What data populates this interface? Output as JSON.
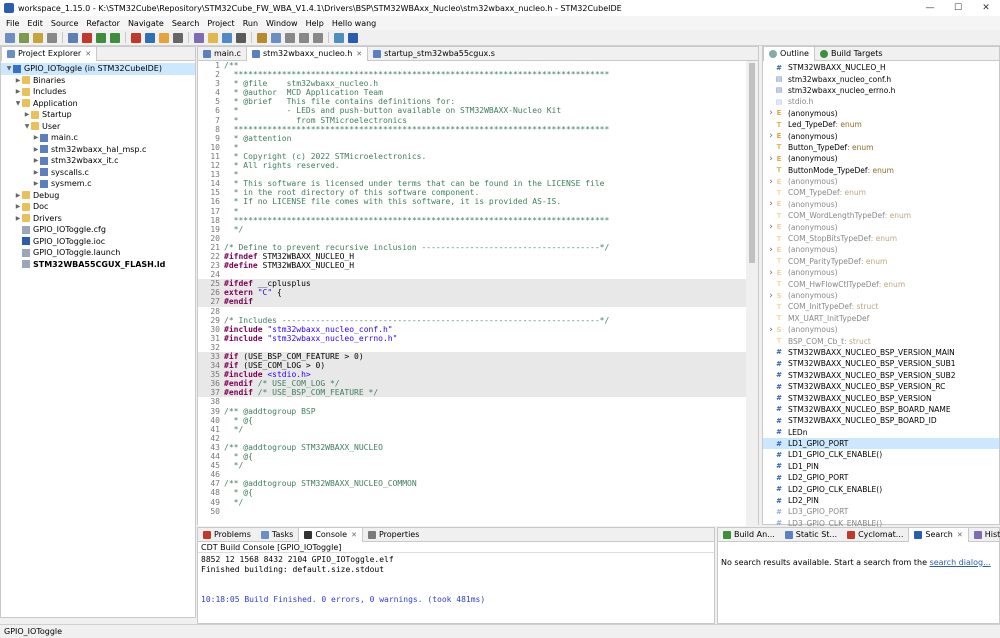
{
  "window": {
    "title": "workspace_1.15.0 - K:\\STM32Cube\\Repository\\STM32Cube_FW_WBA_V1.4.1\\Drivers\\BSP\\STM32WBAxx_Nucleo\\stm32wbaxx_nucleo.h - STM32CubeIDE",
    "minimize": "—",
    "maximize": "☐",
    "close": "✕"
  },
  "menu": [
    "File",
    "Edit",
    "Source",
    "Refactor",
    "Navigate",
    "Search",
    "Project",
    "Run",
    "Window",
    "Help",
    "Hello wang"
  ],
  "explorer": {
    "tab": "Project Explorer",
    "items": [
      {
        "label": "GPIO_IOToggle (in STM32CubeIDE)",
        "depth": 0,
        "tw": "v",
        "icon": "project",
        "sel": true
      },
      {
        "label": "Binaries",
        "depth": 1,
        "tw": ">",
        "icon": "folder"
      },
      {
        "label": "Includes",
        "depth": 1,
        "tw": ">",
        "icon": "folder"
      },
      {
        "label": "Application",
        "depth": 1,
        "tw": "v",
        "icon": "folder"
      },
      {
        "label": "Startup",
        "depth": 2,
        "tw": ">",
        "icon": "folder"
      },
      {
        "label": "User",
        "depth": 2,
        "tw": "v",
        "icon": "folder"
      },
      {
        "label": "main.c",
        "depth": 3,
        "tw": ">",
        "icon": "cfile"
      },
      {
        "label": "stm32wbaxx_hal_msp.c",
        "depth": 3,
        "tw": ">",
        "icon": "cfile"
      },
      {
        "label": "stm32wbaxx_it.c",
        "depth": 3,
        "tw": ">",
        "icon": "cfile"
      },
      {
        "label": "syscalls.c",
        "depth": 3,
        "tw": ">",
        "icon": "cfile"
      },
      {
        "label": "sysmem.c",
        "depth": 3,
        "tw": ">",
        "icon": "cfile"
      },
      {
        "label": "Debug",
        "depth": 1,
        "tw": ">",
        "icon": "folder"
      },
      {
        "label": "Doc",
        "depth": 1,
        "tw": ">",
        "icon": "folder"
      },
      {
        "label": "Drivers",
        "depth": 1,
        "tw": ">",
        "icon": "folder"
      },
      {
        "label": "GPIO_IOToggle.cfg",
        "depth": 1,
        "tw": "",
        "icon": "file"
      },
      {
        "label": "GPIO_IOToggle.ioc",
        "depth": 1,
        "tw": "",
        "icon": "mx"
      },
      {
        "label": "GPIO_IOToggle.launch",
        "depth": 1,
        "tw": "",
        "icon": "file"
      },
      {
        "label": "STM32WBA55CGUX_FLASH.ld",
        "depth": 1,
        "tw": "",
        "icon": "file",
        "bold": true
      }
    ]
  },
  "editor": {
    "tabs": [
      {
        "label": "main.c"
      },
      {
        "label": "stm32wbaxx_nucleo.h",
        "active": true
      },
      {
        "label": "startup_stm32wba55cgux.s"
      }
    ],
    "lines": [
      {
        "n": "1",
        "t": [
          [
            "cm",
            "/**"
          ]
        ]
      },
      {
        "n": "2",
        "t": [
          [
            "cm",
            "  ******************************************************************************"
          ]
        ]
      },
      {
        "n": "3",
        "t": [
          [
            "cm",
            "  * @file    stm32wbaxx_nucleo.h"
          ]
        ]
      },
      {
        "n": "4",
        "t": [
          [
            "cm",
            "  * @author  MCD Application Team"
          ]
        ]
      },
      {
        "n": "5",
        "t": [
          [
            "cm",
            "  * @brief   This file contains definitions for:"
          ]
        ]
      },
      {
        "n": "6",
        "t": [
          [
            "cm",
            "  *          - LEDs and push-button available on STM32WBAXX-Nucleo Kit"
          ]
        ]
      },
      {
        "n": "7",
        "t": [
          [
            "cm",
            "  *            from STMicroelectronics"
          ]
        ]
      },
      {
        "n": "8",
        "t": [
          [
            "cm",
            "  ******************************************************************************"
          ]
        ]
      },
      {
        "n": "9",
        "t": [
          [
            "cm",
            "  * @attention"
          ]
        ]
      },
      {
        "n": "10",
        "t": [
          [
            "cm",
            "  *"
          ]
        ]
      },
      {
        "n": "11",
        "t": [
          [
            "cm",
            "  * Copyright (c) 2022 STMicroelectronics."
          ]
        ]
      },
      {
        "n": "12",
        "t": [
          [
            "cm",
            "  * All rights reserved."
          ]
        ]
      },
      {
        "n": "13",
        "t": [
          [
            "cm",
            "  *"
          ]
        ]
      },
      {
        "n": "14",
        "t": [
          [
            "cm",
            "  * This software is licensed under terms that can be found in the LICENSE file"
          ]
        ]
      },
      {
        "n": "15",
        "t": [
          [
            "cm",
            "  * in the root directory of this software component."
          ]
        ]
      },
      {
        "n": "16",
        "t": [
          [
            "cm",
            "  * If no LICENSE file comes with this software, it is provided AS-IS."
          ]
        ]
      },
      {
        "n": "17",
        "t": [
          [
            "cm",
            "  *"
          ]
        ]
      },
      {
        "n": "18",
        "t": [
          [
            "cm",
            "  ******************************************************************************"
          ]
        ]
      },
      {
        "n": "19",
        "t": [
          [
            "cm",
            "  */"
          ]
        ]
      },
      {
        "n": "20",
        "t": [
          [
            "",
            ""
          ]
        ]
      },
      {
        "n": "21",
        "t": [
          [
            "cm",
            "/* Define to prevent recursive inclusion -------------------------------------*/"
          ]
        ]
      },
      {
        "n": "22",
        "t": [
          [
            "pp",
            "#ifndef"
          ],
          [
            "",
            " STM32WBAXX_NUCLEO_H"
          ]
        ]
      },
      {
        "n": "23",
        "t": [
          [
            "pp",
            "#define"
          ],
          [
            "",
            " STM32WBAXX_NUCLEO_H"
          ]
        ]
      },
      {
        "n": "24",
        "t": [
          [
            "",
            ""
          ]
        ]
      },
      {
        "n": "25",
        "t": [
          [
            "pp",
            "#ifdef"
          ],
          [
            "",
            " __cplusplus"
          ]
        ],
        "hl": true
      },
      {
        "n": "26",
        "t": [
          [
            "pp",
            "extern"
          ],
          [
            "",
            " "
          ],
          [
            "st",
            "\"C\""
          ],
          [
            "",
            " {"
          ]
        ],
        "hl": true
      },
      {
        "n": "27",
        "t": [
          [
            "pp",
            "#endif"
          ]
        ],
        "hl": true
      },
      {
        "n": "28",
        "t": [
          [
            "",
            ""
          ]
        ]
      },
      {
        "n": "29",
        "t": [
          [
            "cm",
            "/* Includes ------------------------------------------------------------------*/"
          ]
        ]
      },
      {
        "n": "30",
        "t": [
          [
            "pp",
            "#include"
          ],
          [
            "",
            " "
          ],
          [
            "st",
            "\"stm32wbaxx_nucleo_conf.h\""
          ]
        ]
      },
      {
        "n": "31",
        "t": [
          [
            "pp",
            "#include"
          ],
          [
            "",
            " "
          ],
          [
            "st",
            "\"stm32wbaxx_nucleo_errno.h\""
          ]
        ]
      },
      {
        "n": "32",
        "t": [
          [
            "",
            ""
          ]
        ]
      },
      {
        "n": "33",
        "t": [
          [
            "pp",
            "#if"
          ],
          [
            "",
            " (USE_BSP_COM_FEATURE > 0)"
          ]
        ],
        "hl": true
      },
      {
        "n": "34",
        "t": [
          [
            "pp",
            "#if"
          ],
          [
            "",
            " (USE_COM_LOG > 0)"
          ]
        ],
        "hl": true
      },
      {
        "n": "35",
        "t": [
          [
            "pp",
            "#include"
          ],
          [
            "",
            " "
          ],
          [
            "st",
            "<stdio.h>"
          ]
        ],
        "hl": true
      },
      {
        "n": "36",
        "t": [
          [
            "pp",
            "#endif"
          ],
          [
            "cm",
            " /* USE_COM_LOG */"
          ]
        ],
        "hl": true
      },
      {
        "n": "37",
        "t": [
          [
            "pp",
            "#endif"
          ],
          [
            "cm",
            " /* USE_BSP_COM_FEATURE */"
          ]
        ],
        "hl": true
      },
      {
        "n": "38",
        "t": [
          [
            "",
            ""
          ]
        ]
      },
      {
        "n": "39",
        "t": [
          [
            "cm",
            "/** @addtogroup BSP"
          ]
        ]
      },
      {
        "n": "40",
        "t": [
          [
            "cm",
            "  * @{"
          ]
        ]
      },
      {
        "n": "41",
        "t": [
          [
            "cm",
            "  */"
          ]
        ]
      },
      {
        "n": "42",
        "t": [
          [
            "",
            ""
          ]
        ]
      },
      {
        "n": "43",
        "t": [
          [
            "cm",
            "/** @addtogroup STM32WBAXX_NUCLEO"
          ]
        ]
      },
      {
        "n": "44",
        "t": [
          [
            "cm",
            "  * @{"
          ]
        ]
      },
      {
        "n": "45",
        "t": [
          [
            "cm",
            "  */"
          ]
        ]
      },
      {
        "n": "46",
        "t": [
          [
            "",
            ""
          ]
        ]
      },
      {
        "n": "47",
        "t": [
          [
            "cm",
            "/** @addtogroup STM32WBAXX_NUCLEO_COMMON"
          ]
        ]
      },
      {
        "n": "48",
        "t": [
          [
            "cm",
            "  * @{"
          ]
        ]
      },
      {
        "n": "49",
        "t": [
          [
            "cm",
            "  */"
          ]
        ]
      },
      {
        "n": "50",
        "t": [
          [
            "",
            ""
          ]
        ]
      }
    ]
  },
  "outline": {
    "tabs": [
      "Outline",
      "Build Targets"
    ],
    "items": [
      {
        "label": "STM32WBAXX_NUCLEO_H",
        "icon": "#"
      },
      {
        "label": "stm32wbaxx_nucleo_conf.h",
        "icon": "inc"
      },
      {
        "label": "stm32wbaxx_nucleo_errno.h",
        "icon": "inc"
      },
      {
        "label": "stdio.h",
        "icon": "inc",
        "gray": true
      },
      {
        "label": "(anonymous)",
        "icon": "enum",
        "tw": true
      },
      {
        "label": "Led_TypeDef",
        "suffix": " : enum",
        "icon": "td"
      },
      {
        "label": "(anonymous)",
        "icon": "enum",
        "tw": true
      },
      {
        "label": "Button_TypeDef",
        "suffix": " : enum",
        "icon": "td"
      },
      {
        "label": "(anonymous)",
        "icon": "enum",
        "tw": true
      },
      {
        "label": "ButtonMode_TypeDef",
        "suffix": " : enum",
        "icon": "td"
      },
      {
        "label": "(anonymous)",
        "icon": "enum",
        "tw": true,
        "gray": true
      },
      {
        "label": "COM_TypeDef",
        "suffix": " : enum",
        "icon": "td",
        "gray": true
      },
      {
        "label": "(anonymous)",
        "icon": "enum",
        "tw": true,
        "gray": true
      },
      {
        "label": "COM_WordLengthTypeDef",
        "suffix": " : enum",
        "icon": "td",
        "gray": true
      },
      {
        "label": "(anonymous)",
        "icon": "enum",
        "tw": true,
        "gray": true
      },
      {
        "label": "COM_StopBitsTypeDef",
        "suffix": " : enum",
        "icon": "td",
        "gray": true
      },
      {
        "label": "(anonymous)",
        "icon": "enum",
        "tw": true,
        "gray": true
      },
      {
        "label": "COM_ParityTypeDef",
        "suffix": " : enum",
        "icon": "td",
        "gray": true
      },
      {
        "label": "(anonymous)",
        "icon": "enum",
        "tw": true,
        "gray": true
      },
      {
        "label": "COM_HwFlowCtlTypeDef",
        "suffix": " : enum",
        "icon": "td",
        "gray": true
      },
      {
        "label": "(anonymous)",
        "icon": "struct",
        "tw": true,
        "gray": true
      },
      {
        "label": "COM_InitTypeDef",
        "suffix": " : struct",
        "icon": "td",
        "gray": true
      },
      {
        "label": "MX_UART_InitTypeDef",
        "icon": "td",
        "gray": true
      },
      {
        "label": "(anonymous)",
        "icon": "struct",
        "tw": true,
        "gray": true
      },
      {
        "label": "BSP_COM_Cb_t",
        "suffix": " : struct",
        "icon": "td",
        "gray": true
      },
      {
        "label": "STM32WBAXX_NUCLEO_BSP_VERSION_MAIN",
        "icon": "#"
      },
      {
        "label": "STM32WBAXX_NUCLEO_BSP_VERSION_SUB1",
        "icon": "#"
      },
      {
        "label": "STM32WBAXX_NUCLEO_BSP_VERSION_SUB2",
        "icon": "#"
      },
      {
        "label": "STM32WBAXX_NUCLEO_BSP_VERSION_RC",
        "icon": "#"
      },
      {
        "label": "STM32WBAXX_NUCLEO_BSP_VERSION",
        "icon": "#"
      },
      {
        "label": "STM32WBAXX_NUCLEO_BSP_BOARD_NAME",
        "icon": "#"
      },
      {
        "label": "STM32WBAXX_NUCLEO_BSP_BOARD_ID",
        "icon": "#"
      },
      {
        "label": "LEDn",
        "icon": "#"
      },
      {
        "label": "LD1_GPIO_PORT",
        "icon": "#",
        "sel": true
      },
      {
        "label": "LD1_GPIO_CLK_ENABLE()",
        "icon": "#"
      },
      {
        "label": "LD1_PIN",
        "icon": "#"
      },
      {
        "label": "LD2_GPIO_PORT",
        "icon": "#"
      },
      {
        "label": "LD2_GPIO_CLK_ENABLE()",
        "icon": "#"
      },
      {
        "label": "LD2_PIN",
        "icon": "#"
      },
      {
        "label": "LD3_GPIO_PORT",
        "icon": "#",
        "gray": true
      },
      {
        "label": "LD3_GPIO_CLK_ENABLE()",
        "icon": "#",
        "gray": true
      }
    ]
  },
  "console": {
    "tabs": [
      "Problems",
      "Tasks",
      "Console",
      "Properties"
    ],
    "header": "CDT Build Console [GPIO_IOToggle]",
    "lines": [
      {
        "text": "   8852      12    1568     8432    2104 GPIO_IOToggle.elf",
        "color": "#000"
      },
      {
        "text": "Finished building: default.size.stdout",
        "color": "#000"
      },
      {
        "text": "",
        "color": "#000"
      },
      {
        "text": "",
        "color": "#000"
      },
      {
        "text": "10:18:05 Build Finished. 0 errors, 0 warnings. (took 481ms)",
        "color": "#2a3fd6"
      }
    ]
  },
  "search": {
    "tabs": [
      "Build An...",
      "Static St...",
      "Cyclomat...",
      "Search",
      "History"
    ],
    "message": "No search results available. Start a search from the ",
    "link": "search dialog..."
  },
  "status": {
    "text": "GPIO_IOToggle"
  }
}
